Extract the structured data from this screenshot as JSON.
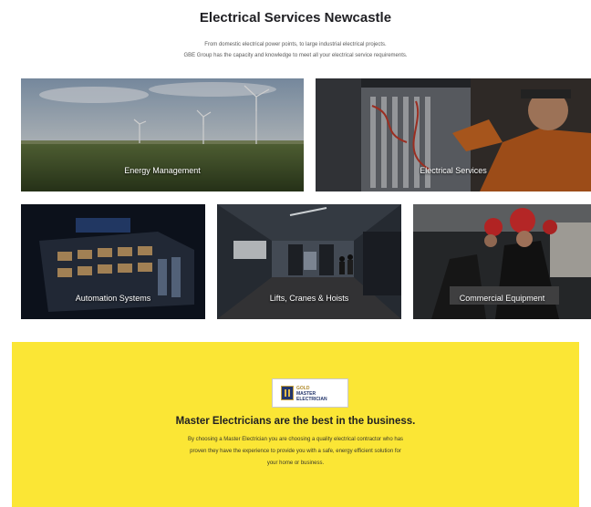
{
  "header": {
    "title": "Electrical Services Newcastle",
    "intro_line1": "From domestic electrical power points, to large industrial electrical projects.",
    "intro_line2": "GBE Group has the capacity and knowledge to meet all your electrical service requirements."
  },
  "services": [
    {
      "label": "Energy Management"
    },
    {
      "label": "Electrical Services"
    },
    {
      "label": "Automation Systems"
    },
    {
      "label": "Lifts, Cranes & Hoists"
    },
    {
      "label": "Commercial Equipment"
    }
  ],
  "promo": {
    "badge_line1": "GOLD",
    "badge_line2": "MASTER",
    "badge_line3": "ELECTRICIAN",
    "heading": "Master Electricians are the best in the business.",
    "body_line1": "By choosing a Master Electrician you are choosing a quality electrical contractor who has",
    "body_line2": "proven they have the experience to provide you with a safe, energy efficient solution for",
    "body_line3": "your home or business.",
    "background": "#fbe635"
  },
  "icons": {
    "badge_emblem": "master-electrician-emblem-icon"
  }
}
